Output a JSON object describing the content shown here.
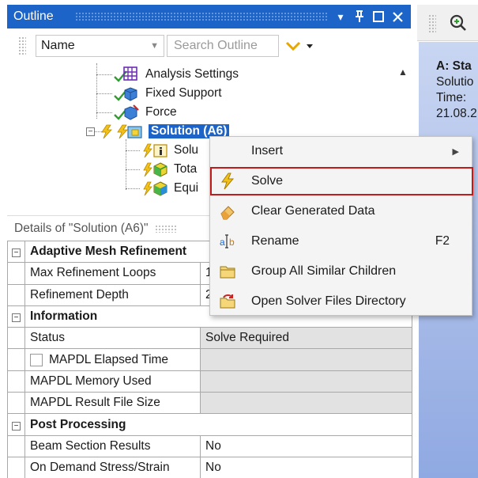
{
  "outline": {
    "title": "Outline",
    "buttons": {
      "dropdown": "▾",
      "pin": "ǂ",
      "maximize": "☐",
      "close": "✕"
    },
    "filter_select": "Name",
    "search_placeholder": "Search Outline"
  },
  "tree": {
    "items": [
      {
        "label": "Analysis Settings",
        "icon": "analysis-settings-icon"
      },
      {
        "label": "Fixed Support",
        "icon": "fixed-support-icon"
      },
      {
        "label": "Force",
        "icon": "force-icon"
      },
      {
        "label": "Solution (A6)",
        "icon": "solution-icon",
        "selected": true
      },
      {
        "label": "Solu",
        "icon": "solution-information-icon"
      },
      {
        "label": "Tota",
        "icon": "total-deformation-icon"
      },
      {
        "label": "Equi",
        "icon": "equivalent-stress-icon"
      }
    ]
  },
  "details": {
    "header": "Details of \"Solution (A6)\"",
    "rows": [
      {
        "type": "section",
        "label": "Adaptive Mesh Refinement",
        "value": ""
      },
      {
        "type": "field",
        "label": "Max Refinement Loops",
        "value": "1"
      },
      {
        "type": "field",
        "label": "Refinement Depth",
        "value": "2"
      },
      {
        "type": "section",
        "label": "Information",
        "value": ""
      },
      {
        "type": "field",
        "label": "Status",
        "value": "Solve Required"
      },
      {
        "type": "field",
        "label": "MAPDL Elapsed Time",
        "value": "",
        "checkbox": true
      },
      {
        "type": "field",
        "label": "MAPDL Memory Used",
        "value": ""
      },
      {
        "type": "field",
        "label": "MAPDL Result File Size",
        "value": ""
      },
      {
        "type": "section",
        "label": "Post Processing",
        "value": ""
      },
      {
        "type": "field",
        "label": "Beam Section Results",
        "value": "No"
      },
      {
        "type": "field",
        "label": "On Demand Stress/Strain",
        "value": "No"
      }
    ]
  },
  "context_menu": {
    "items": [
      {
        "label": "Insert",
        "submenu": true,
        "icon": ""
      },
      {
        "label": "Solve",
        "icon": "solve-lightning-icon",
        "highlighted": true
      },
      {
        "label": "Clear Generated Data",
        "icon": "eraser-icon"
      },
      {
        "label": "Rename",
        "icon": "rename-icon",
        "shortcut": "F2"
      },
      {
        "label": "Group All Similar Children",
        "icon": "folder-icon"
      },
      {
        "label": "Open Solver Files Directory",
        "icon": "open-folder-icon"
      }
    ]
  },
  "right_panel": {
    "title": "A: Sta",
    "lines": [
      "Solutio",
      "Time: ",
      "21.08.2"
    ]
  },
  "colors": {
    "accent": "#1c64c8",
    "highlight_border": "#c01c1c",
    "lightning_yellow": "#f2c21b",
    "check_green": "#2f9e2f"
  }
}
